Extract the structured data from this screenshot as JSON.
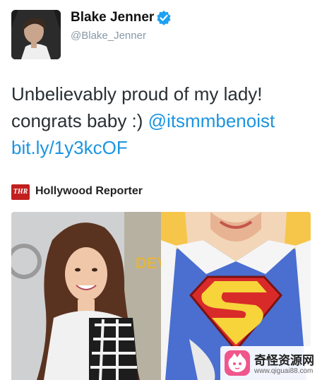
{
  "tweet": {
    "author_name": "Blake Jenner",
    "author_handle": "@Blake_Jenner",
    "text_line1": "Unbelievably proud of my lady!",
    "text_line2_prefix": "congrats baby :) ",
    "mention": "@itsmmbenoist",
    "link": "bit.ly/1y3kcOF"
  },
  "card": {
    "source_logo_text": "THR",
    "source_name": "Hollywood Reporter"
  },
  "watermark": {
    "title": "奇怪资源网",
    "url": "www.qiguai88.com"
  },
  "colors": {
    "link": "#1b95e0",
    "verified": "#1da1f2",
    "text": "#292f33",
    "handle": "#8899a6"
  }
}
